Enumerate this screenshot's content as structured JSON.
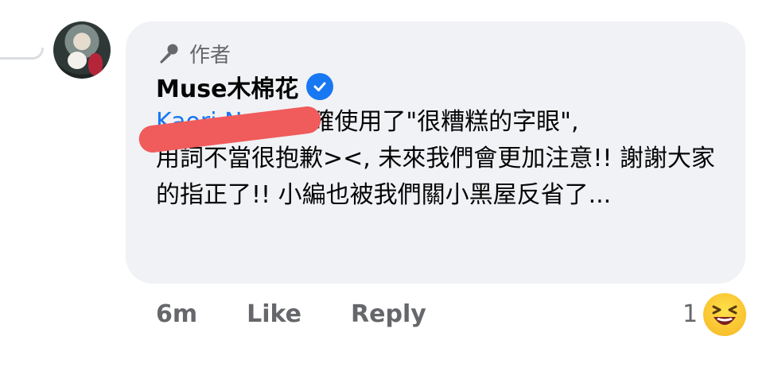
{
  "comment": {
    "author_label": "作者",
    "author_name": "Muse木棉花",
    "mention_text": "Kaori Naga",
    "message_first_line": "的確使用了\"很糟糕的字眼\",",
    "message_rest": "用詞不當很抱歉><, 未來我們會更加注意!! 謝謝大家的指正了!! 小編也被我們關小黑屋反省了..."
  },
  "actions": {
    "time": "6m",
    "like_label": "Like",
    "reply_label": "Reply"
  },
  "reactions": {
    "count": "1",
    "emoji_icon": "laughing-face-icon"
  },
  "colors": {
    "bubble": "#f0f2f5",
    "verified": "#1877f2",
    "mention": "#1877f2",
    "redaction": "#f05b5b",
    "secondary_text": "#65676b"
  }
}
